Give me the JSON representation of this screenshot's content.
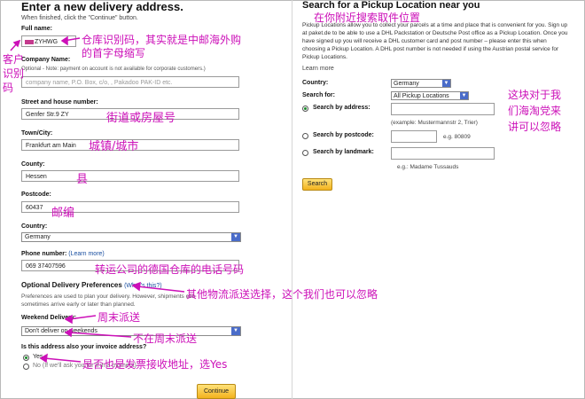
{
  "form": {
    "title": "Enter a new delivery address.",
    "hint": "When finished, click the \"Continue\" button.",
    "full_name_label": "Full name:",
    "full_name_value": "ZYHWG",
    "company_label": "Company Name:",
    "company_note": "Optional - Note: payment on account is not available for corporate customers.)",
    "company_placeholder": "company name, P.O. Box, c/o, , Pakadoo PAK-ID etc.",
    "street_label": "Street and house number:",
    "street_value": "Genfer Str.9 ZY",
    "town_label": "Town/City:",
    "town_value": "Frankfurt am Main",
    "county_label": "County:",
    "county_value": "Hessen",
    "postcode_label": "Postcode:",
    "postcode_value": "60437",
    "country_label": "Country:",
    "country_value": "Germany",
    "phone_label": "Phone number:",
    "phone_learn": "(Learn more)",
    "phone_value": "069 37407596",
    "optional_title": "Optional Delivery Preferences",
    "optional_link": "(What's this?)",
    "optional_desc_1": "Preferences are used to plan your delivery. However, shipments can",
    "optional_desc_2": "sometimes arrive early or later than planned.",
    "weekend_label": "Weekend Delivery:",
    "weekend_value": "Don't deliver on weekends",
    "invoice_question": "Is this address also your invoice address?",
    "yes_label": "Yes",
    "no_label": "No (If we'll ask you for it in a moment)",
    "continue_label": "Continue"
  },
  "pickup": {
    "title": "Search for a Pickup Location near you",
    "description": "Pickup Locations allow you to collect your parcels at a time and place that is convenient for you. Sign up at paket.de to be able to use a DHL Packstation or Deutsche Post office as a Pickup Location. Once you have signed up you will receive a DHL customer card and post number – please enter this when choosing a Pickup Location. A DHL post number is not needed if using the Austrian postal service for Pickup Locations.",
    "learn_more": "Learn more",
    "country_label": "Country:",
    "country_value": "Germany",
    "search_for_label": "Search for:",
    "search_for_value": "All Pickup Locations",
    "by_address": "Search by address:",
    "address_example": "(example: Mustermannstr 2, Trier)",
    "by_postcode": "Search by postcode:",
    "postcode_example": "e.g. 80809",
    "by_landmark": "Search by landmark:",
    "landmark_example": "e.g.: Madame Tussauds",
    "search_button": "Search"
  },
  "annotations": {
    "pickup_heading": "在你附近搜索取件位置",
    "warehouse_code_1": "仓库识别码，其实就是中邮海外购",
    "warehouse_code_2": "的首字母缩写",
    "customer_code_1": "客户",
    "customer_code_2": "识别",
    "customer_code_3": "码",
    "street": "街道或房屋号",
    "town": "城镇/城市",
    "county": "县",
    "postcode": "邮编",
    "phone": "转运公司的德国仓库的电话号码",
    "ignore_right_1": "这块对于我",
    "ignore_right_2": "们海淘党来",
    "ignore_right_3": "讲可以忽略",
    "optional": "其他物流派送选择，这个我们也可以忽略",
    "weekend": "周末派送",
    "no_weekend": "不在周末派送",
    "invoice": "是否也是发票接收地址，选Yes"
  },
  "colors": {
    "annotation": "#cc10b8",
    "link": "#1a4fa0",
    "button": "#f3b21d"
  }
}
